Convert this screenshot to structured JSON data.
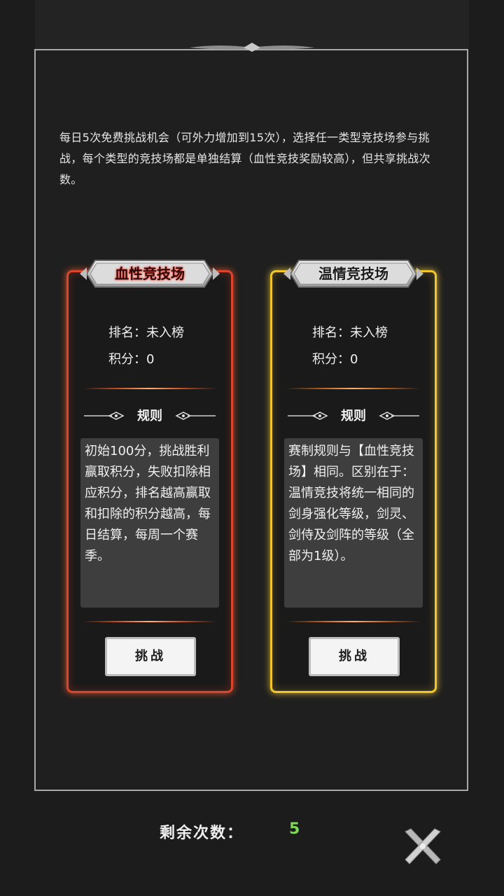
{
  "intro_text": "每日5次免费挑战机会（可外力增加到15次），选择任一类型竞技场参与挑战，每个类型的竞技场都是单独结算（血性竞技奖励较高），但共享挑战次数。",
  "arenas": [
    {
      "title": "血性竞技场",
      "rank": "排名：未入榜",
      "score": "积分：0",
      "rules_heading": "规则",
      "rules_text": "初始100分，挑战胜利赢取积分，失败扣除相应积分，排名越高赢取和扣除的积分越高，每日结算，每周一个赛季。",
      "button_label": "挑战",
      "accent_color": "#d9452d"
    },
    {
      "title": "温情竞技场",
      "rank": "排名：未入榜",
      "score": "积分：0",
      "rules_heading": "规则",
      "rules_text": "赛制规则与【血性竞技场】相同。区别在于：温情竞技将统一相同的剑身强化等级，剑灵、剑侍及剑阵的等级（全部为1级）。",
      "button_label": "挑战",
      "accent_color": "#f1c62d"
    }
  ],
  "footer": {
    "remaining_label": "剩余次数：",
    "remaining_value": "5",
    "remaining_color": "#7ed957",
    "close_icon": "crossed-swords-close-icon"
  }
}
